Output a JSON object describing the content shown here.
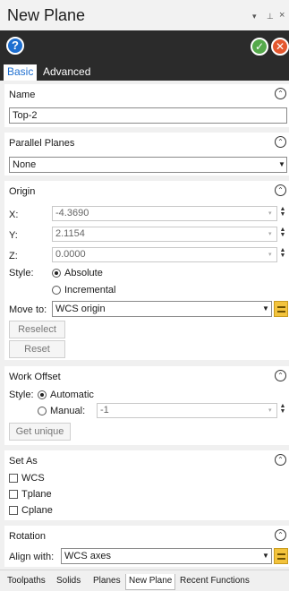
{
  "window": {
    "title": "New Plane",
    "pin_icon": "pin-icon",
    "dropdown_icon": "chevron-down-icon",
    "close_icon": "close-icon"
  },
  "toolbar": {
    "help": "?",
    "ok": "✓",
    "cancel": "✕"
  },
  "tabs": [
    {
      "label": "Basic",
      "active": true
    },
    {
      "label": "Advanced",
      "active": false
    }
  ],
  "name_section": {
    "title": "Name",
    "value": "Top-2"
  },
  "parallel_section": {
    "title": "Parallel Planes",
    "value": "None"
  },
  "origin_section": {
    "title": "Origin",
    "x_label": "X:",
    "x_value": "-4.3690",
    "y_label": "Y:",
    "y_value": "2.1154",
    "z_label": "Z:",
    "z_value": "0.0000",
    "style_label": "Style:",
    "absolute_label": "Absolute",
    "absolute_selected": true,
    "incremental_label": "Incremental",
    "incremental_selected": false,
    "move_to_label": "Move to:",
    "move_to_value": "WCS origin",
    "reselect_label": "Reselect",
    "reset_label": "Reset"
  },
  "work_offset_section": {
    "title": "Work Offset",
    "style_label": "Style:",
    "automatic_label": "Automatic",
    "automatic_selected": true,
    "manual_label": "Manual:",
    "manual_selected": false,
    "manual_value": "-1",
    "get_unique_label": "Get unique"
  },
  "set_as_section": {
    "title": "Set As",
    "items": [
      {
        "label": "WCS",
        "checked": false
      },
      {
        "label": "Tplane",
        "checked": false
      },
      {
        "label": "Cplane",
        "checked": false
      }
    ]
  },
  "rotation_section": {
    "title": "Rotation",
    "align_label": "Align with:",
    "align_value": "WCS axes"
  },
  "bottom_tabs": [
    {
      "label": "Toolpaths",
      "active": false
    },
    {
      "label": "Solids",
      "active": false
    },
    {
      "label": "Planes",
      "active": false
    },
    {
      "label": "New Plane",
      "active": true
    },
    {
      "label": "Recent Functions",
      "active": false
    }
  ]
}
